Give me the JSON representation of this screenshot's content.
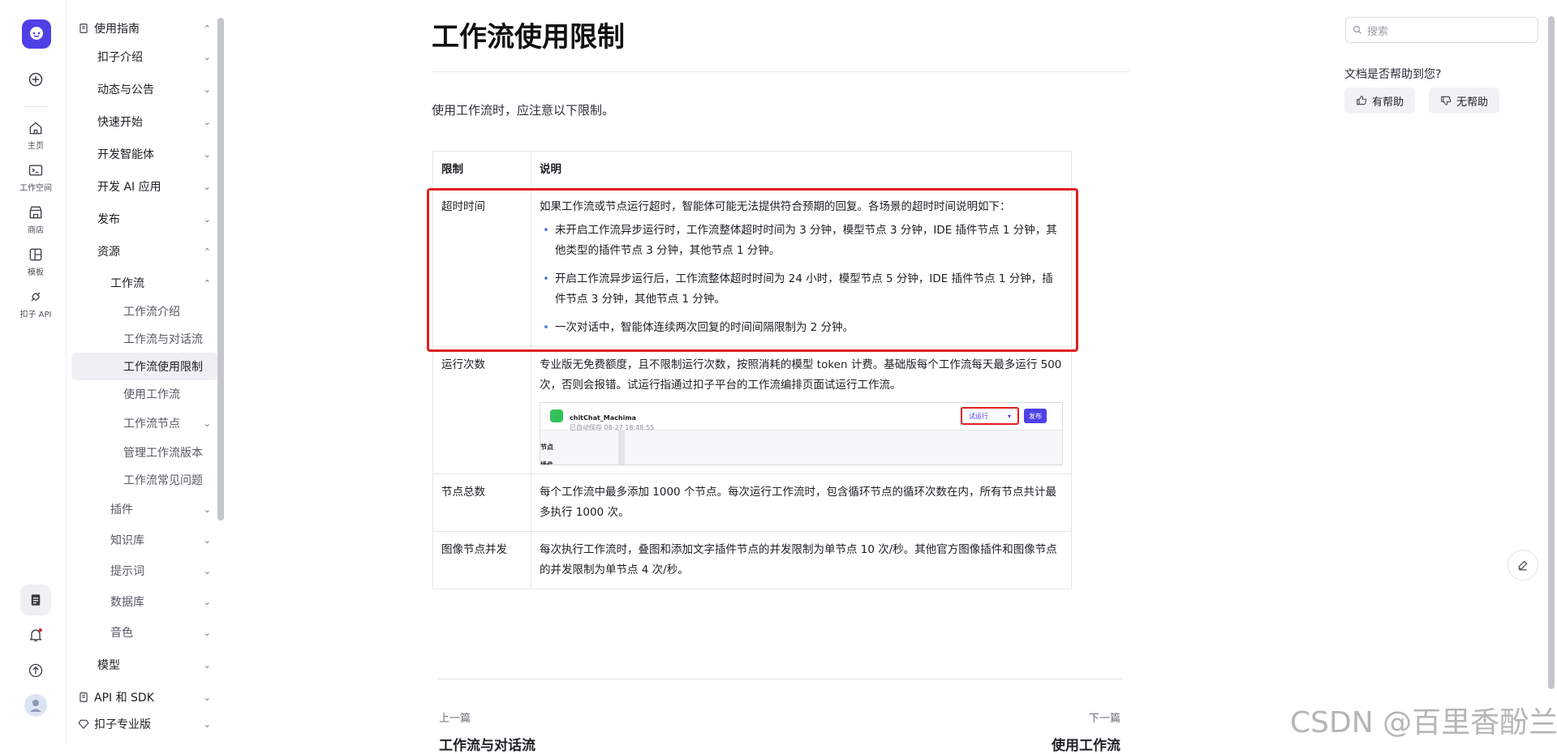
{
  "rail": {
    "items": [
      {
        "label": "主页",
        "icon": "home-icon"
      },
      {
        "label": "工作空间",
        "icon": "terminal-icon"
      },
      {
        "label": "商店",
        "icon": "store-icon"
      },
      {
        "label": "模板",
        "icon": "template-icon"
      },
      {
        "label": "扣子 API",
        "icon": "api-icon"
      }
    ]
  },
  "nav": {
    "section_guide": "使用指南",
    "items": [
      "扣子介绍",
      "动态与公告",
      "快速开始",
      "开发智能体",
      "开发 AI 应用",
      "发布",
      "资源"
    ],
    "workflow": "工作流",
    "workflow_children": [
      "工作流介绍",
      "工作流与对话流",
      "工作流使用限制",
      "使用工作流",
      "工作流节点",
      "管理工作流版本",
      "工作流常见问题"
    ],
    "resource_children": [
      "插件",
      "知识库",
      "提示词",
      "数据库",
      "音色"
    ],
    "model": "模型",
    "api_sdk": "API 和 SDK",
    "pro": "扣子专业版"
  },
  "page": {
    "title": "工作流使用限制",
    "intro": "使用工作流时，应注意以下限制。",
    "table": {
      "headers": [
        "限制",
        "说明"
      ],
      "timeout": {
        "name": "超时时间",
        "lead": "如果工作流或节点运行超时，智能体可能无法提供符合预期的回复。各场景的超时时间说明如下：",
        "bullets": [
          "未开启工作流异步运行时，工作流整体超时时间为 3 分钟，模型节点 3 分钟，IDE 插件节点 1 分钟，其他类型的插件节点 3 分钟，其他节点 1 分钟。",
          "开启工作流异步运行后，工作流整体超时时间为 24 小时，模型节点 5 分钟，IDE 插件节点 1 分钟，插件节点 3 分钟，其他节点 1 分钟。",
          "一次对话中，智能体连续两次回复的时间间隔限制为 2 分钟。"
        ]
      },
      "runs": {
        "name": "运行次数",
        "desc": "专业版无免费额度，且不限制运行次数，按照消耗的模型 token 计费。基础版每个工作流每天最多运行 500 次，否则会报错。试运行指通过扣子平台的工作流编排页面试运行工作流。",
        "shot": {
          "app": "chitChat_Machima",
          "saved": "已自动保存 08-27 18:48:55",
          "run": "试运行",
          "publish": "发布",
          "node": "节点",
          "plugin": "插件"
        }
      },
      "nodes": {
        "name": "节点总数",
        "desc": "每个工作流中最多添加 1000 个节点。每次运行工作流时，包含循环节点的循环次数在内，所有节点共计最多执行 1000 次。"
      },
      "image": {
        "name": "图像节点并发",
        "desc": "每次执行工作流时，叠图和添加文字插件节点的并发限制为单节点 10 次/秒。其他官方图像插件和图像节点的并发限制为单节点 4 次/秒。"
      }
    },
    "prev_label": "上一篇",
    "next_label": "下一篇",
    "prev_title": "工作流与对话流",
    "next_title": "使用工作流"
  },
  "right": {
    "search_placeholder": "搜索",
    "help_question": "文档是否帮助到您?",
    "helpful": "有帮助",
    "not_helpful": "无帮助"
  },
  "watermark": "CSDN @百里香酚兰",
  "colors": {
    "brand": "#4e40e5",
    "highlight": "#e02020"
  }
}
